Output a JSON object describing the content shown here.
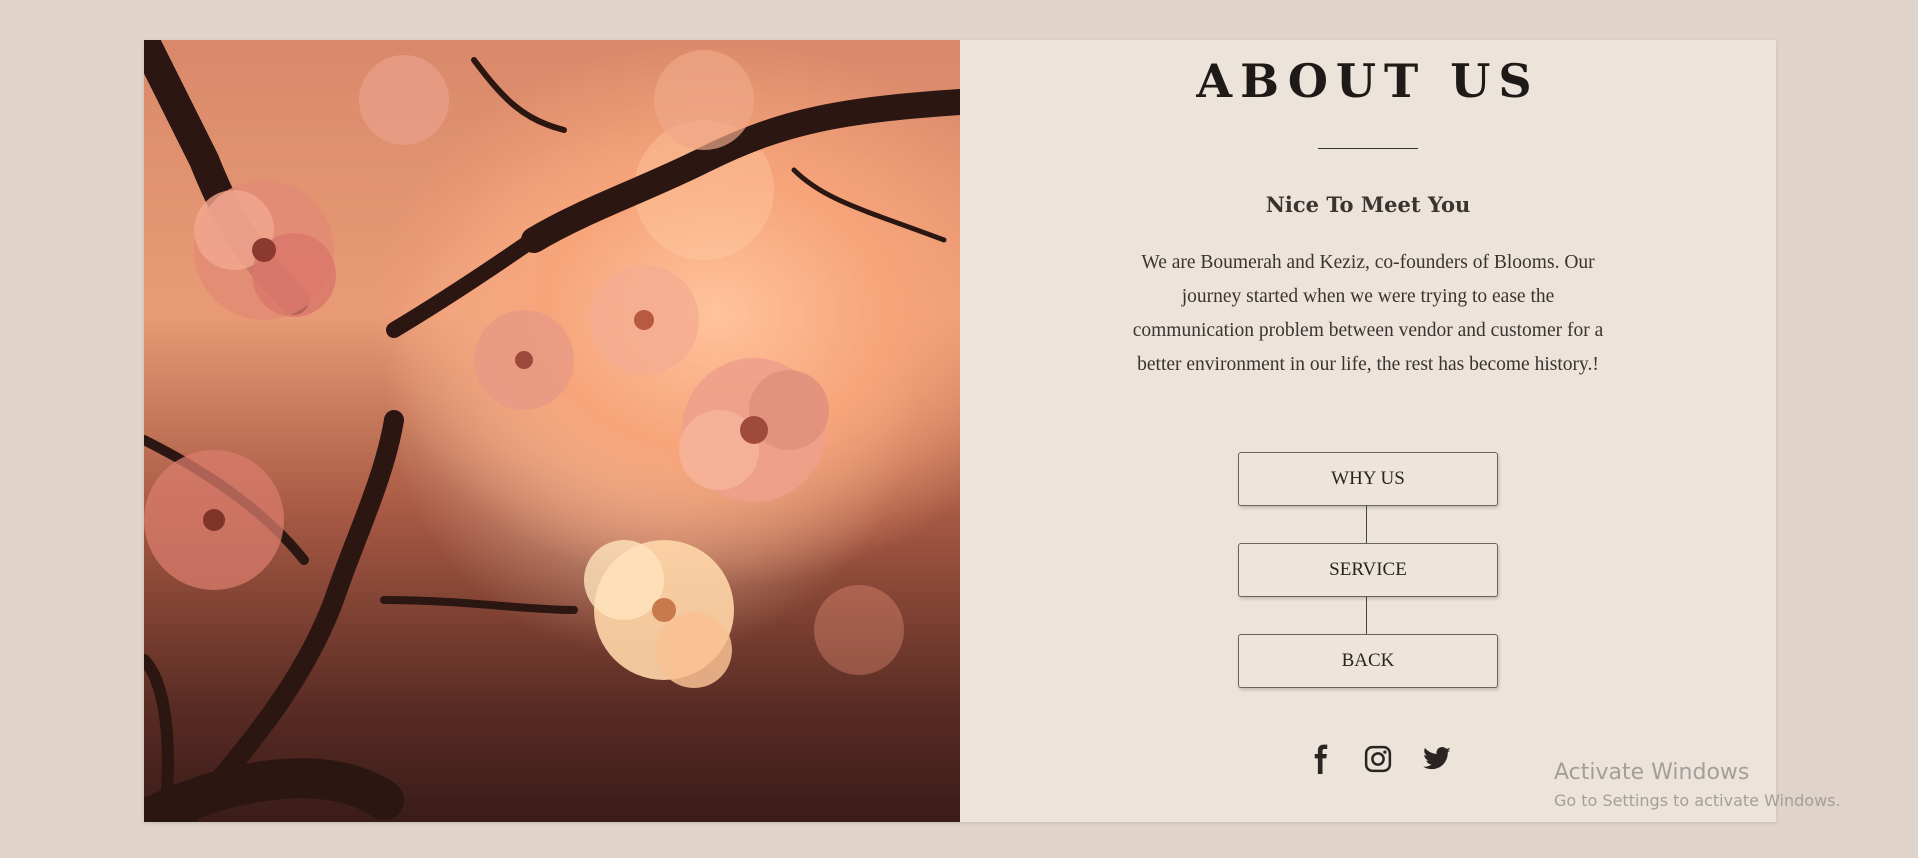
{
  "about": {
    "title": "ABOUT US",
    "subtitle": "Nice To Meet You",
    "paragraph": "We are Boumerah and Keziz, co-founders of Blooms. Our journey started when we were trying to ease the communication problem between vendor and customer for a better environment in our life, the rest has become history.!"
  },
  "buttons": {
    "why_us": "WHY US",
    "service": "SERVICE",
    "back": "BACK"
  },
  "social": {
    "icons": [
      "facebook-icon",
      "instagram-icon",
      "twitter-icon"
    ]
  },
  "watermark": {
    "line1": "Activate Windows",
    "line2": "Go to Settings to activate Windows."
  },
  "colors": {
    "page_background": "#e0d3c9",
    "panel_background": "#ece3db",
    "text": "#3a3330"
  }
}
